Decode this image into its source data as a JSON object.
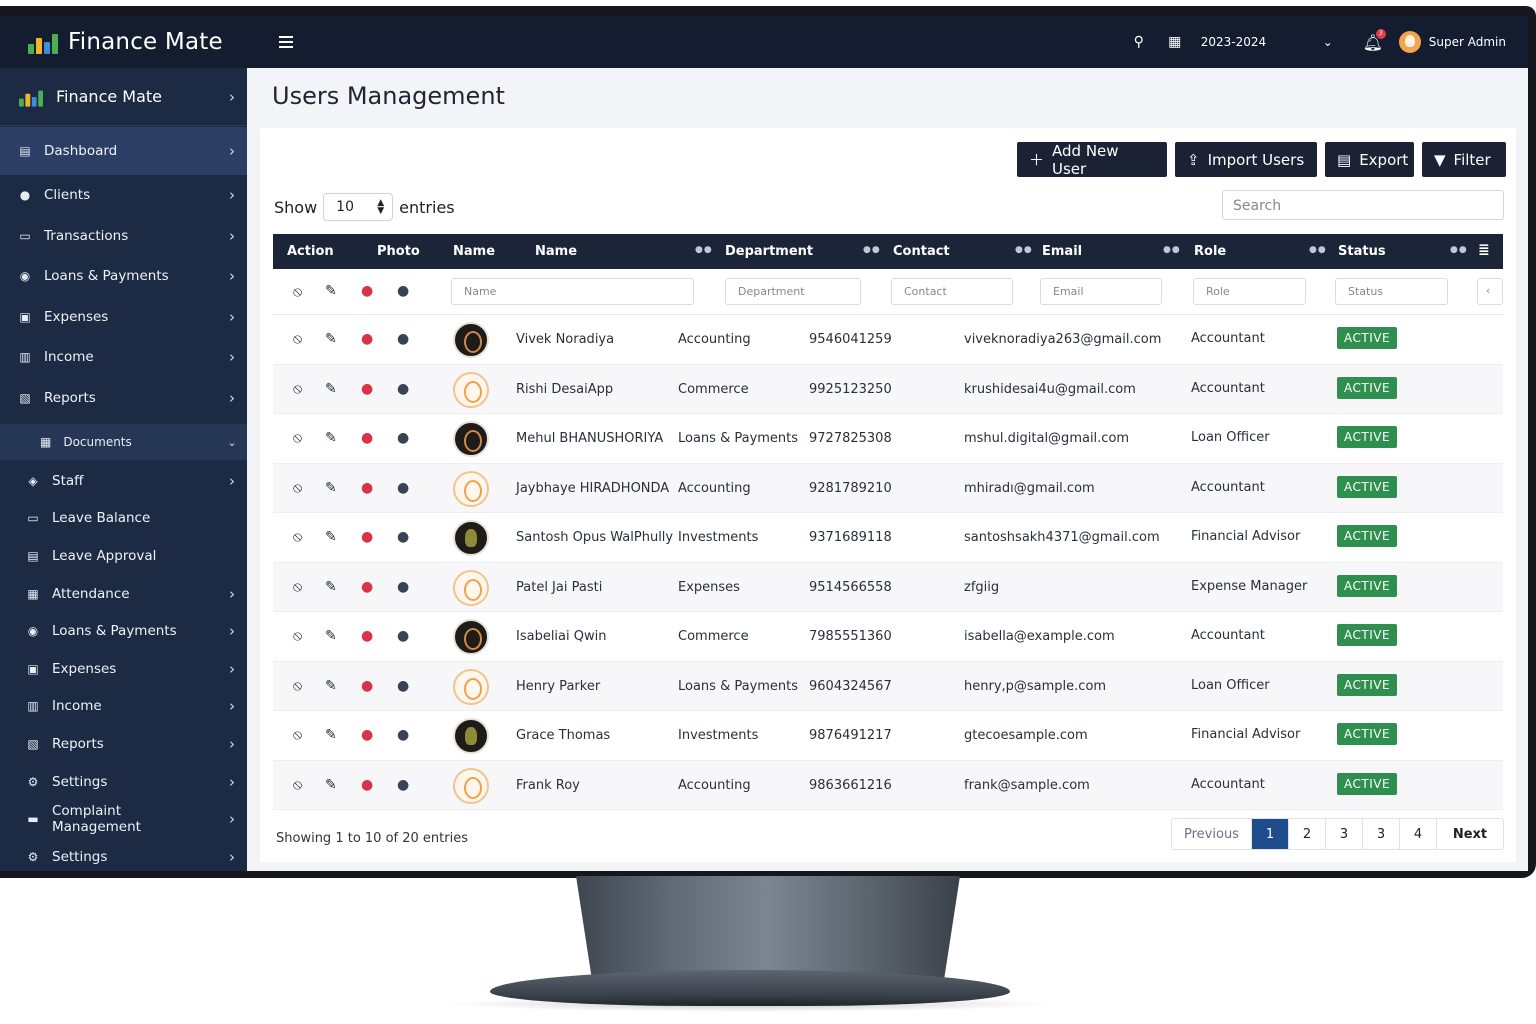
{
  "brand": {
    "name": "Finance Mate"
  },
  "sidebar": {
    "head": "Finance Mate",
    "items": [
      {
        "label": "Dashboard",
        "icon": "dashboard-icon"
      },
      {
        "label": "Clients",
        "icon": "user-icon"
      },
      {
        "label": "Transactions",
        "icon": "card-icon"
      },
      {
        "label": "Loans & Payments",
        "icon": "coins-icon"
      },
      {
        "label": "Expenses",
        "icon": "wallet-icon"
      },
      {
        "label": "Income",
        "icon": "money-icon"
      },
      {
        "label": "Reports",
        "icon": "report-icon"
      }
    ],
    "documents": "Documents",
    "sub_items": [
      {
        "label": "Staff"
      },
      {
        "label": "Leave Balance"
      },
      {
        "label": "Leave Approval"
      },
      {
        "label": "Attendance"
      },
      {
        "label": "Loans & Payments"
      },
      {
        "label": "Expenses"
      },
      {
        "label": "Income"
      },
      {
        "label": "Reports"
      },
      {
        "label": "Settings"
      },
      {
        "label": "Complaint Management"
      },
      {
        "label": "Settings"
      }
    ]
  },
  "topbar": {
    "year": "2023-2024",
    "user": "Super Admin",
    "notif_count": "3"
  },
  "page": {
    "title": "Users Management"
  },
  "toolbar": {
    "add": "Add New User",
    "import": "Import Users",
    "export": "Export",
    "filter": "Filter"
  },
  "table_controls": {
    "show": "Show",
    "entries_value": "10",
    "entries": "entries",
    "search_placeholder": "Search"
  },
  "columns": {
    "action": "Action",
    "photo": "Photo",
    "name1": "Name",
    "name": "Name",
    "department": "Department",
    "contact": "Contact",
    "email": "Email",
    "role": "Role",
    "status": "Status"
  },
  "filters": {
    "name": "Name",
    "department": "Department",
    "contact": "Contact",
    "email": "Email",
    "role": "Role",
    "status": "Status"
  },
  "rows": [
    {
      "name": "Vivek Noradiya",
      "department": "Accounting",
      "contact": "9546041259",
      "email": "viveknoradiya263@gmail.com",
      "role": "Accountant",
      "status": "ACTIVE",
      "photo": "dark"
    },
    {
      "name": "Rishi DesaiApp",
      "department": "Commerce",
      "contact": "9925123250",
      "email": "krushidesai4u@gmail.com",
      "role": "Accountant",
      "status": "ACTIVE",
      "photo": "light"
    },
    {
      "name": "Mehul BHANUSHORIYA",
      "department": "Loans & Payments",
      "contact": "9727825308",
      "email": "mshul.digital@gmail.com",
      "role": "Loan Officer",
      "status": "ACTIVE",
      "photo": "dark"
    },
    {
      "name": "Jaybhaye HIRADHONDA",
      "department": "Accounting",
      "contact": "9281789210",
      "email": "mhiradı@gmail.com",
      "role": "Accountant",
      "status": "ACTIVE",
      "photo": "light"
    },
    {
      "name": "Santosh Opus WalPhully",
      "department": "Investments",
      "contact": "9371689118",
      "email": "santoshsakh4371@gmail.com",
      "role": "Financial Advisor",
      "status": "ACTIVE",
      "photo": "olive"
    },
    {
      "name": "Patel Jai Pasti",
      "department": "Expenses",
      "contact": "9514566558",
      "email": "zfgiig",
      "role": "Expense Manager",
      "status": "ACTIVE",
      "photo": "light"
    },
    {
      "name": "Isabeliai Qwin",
      "department": "Commerce",
      "contact": "7985551360",
      "email": "isabella@example.com",
      "role": "Accountant",
      "status": "ACTIVE",
      "photo": "dark"
    },
    {
      "name": "Henry Parker",
      "department": "Loans & Payments",
      "contact": "9604324567",
      "email": "henry,p@sample.com",
      "role": "Loan Officer",
      "status": "ACTIVE",
      "photo": "light"
    },
    {
      "name": "Grace Thomas",
      "department": "Investments",
      "contact": "9876491217",
      "email": "gtecoesample.com",
      "role": "Financial Advisor",
      "status": "ACTIVE",
      "photo": "olive"
    },
    {
      "name": "Frank Roy",
      "department": "Accounting",
      "contact": "9863661216",
      "email": "frank@sample.com",
      "role": "Accountant",
      "status": "ACTIVE",
      "photo": "light"
    }
  ],
  "footer": {
    "showing": "Showing 1 to 10 of 20 entries"
  },
  "pager": {
    "prev": "Previous",
    "pages": [
      "1",
      "2",
      "3",
      "3",
      "4"
    ],
    "next": "Next"
  },
  "colors": {
    "sidebar": "#1d2a44",
    "topbar": "#141d30",
    "active_badge": "#2f8f4e",
    "accent": "#1f4c8c"
  }
}
